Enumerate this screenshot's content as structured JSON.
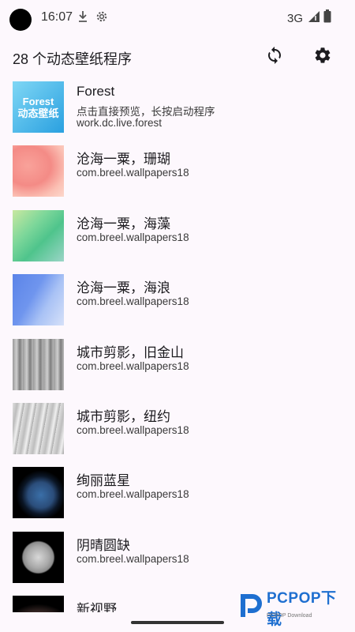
{
  "status_bar": {
    "time": "16:07",
    "network": "3G",
    "icons": [
      "download-icon",
      "settings-gear-small-icon",
      "signal-icon",
      "battery-icon"
    ]
  },
  "app_bar": {
    "title": "28 个动态壁纸程序",
    "refresh_icon": "refresh-icon",
    "settings_icon": "settings-icon"
  },
  "items": [
    {
      "title": "Forest",
      "subtitle": "点击直接预览，长按启动程序",
      "package": "work.dc.live.forest",
      "thumb_line1": "Forest",
      "thumb_line2": "动态壁纸"
    },
    {
      "title": "沧海一粟，珊瑚",
      "package": "com.breel.wallpapers18"
    },
    {
      "title": "沧海一粟，海藻",
      "package": "com.breel.wallpapers18"
    },
    {
      "title": "沧海一粟，海浪",
      "package": "com.breel.wallpapers18"
    },
    {
      "title": "城市剪影，旧金山",
      "package": "com.breel.wallpapers18"
    },
    {
      "title": "城市剪影，纽约",
      "package": "com.breel.wallpapers18"
    },
    {
      "title": "绚丽蓝星",
      "package": "com.breel.wallpapers18"
    },
    {
      "title": "阴晴圆缺",
      "package": "com.breel.wallpapers18"
    },
    {
      "title": "新视野",
      "package": ""
    }
  ],
  "watermark": {
    "text": "PCPOP下载",
    "sub": "PCPOP Download"
  },
  "colors": {
    "background": "#fdf8fd",
    "text": "#1c1b1f",
    "watermark": "#1e6fd0"
  }
}
